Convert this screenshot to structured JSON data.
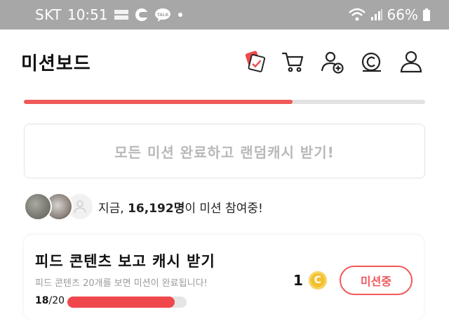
{
  "status_bar": {
    "carrier": "SKT",
    "time": "10:51",
    "battery": "66%",
    "icons": [
      "memo-icon",
      "c-icon",
      "talk-icon",
      "dot-icon",
      "wifi-icon",
      "signal-icon",
      "battery-icon"
    ],
    "talk_label": "TALK"
  },
  "header": {
    "title": "미션보드",
    "icons": [
      "mission-card-icon",
      "cart-icon",
      "add-friend-icon",
      "cash-icon",
      "profile-icon"
    ]
  },
  "progress": {
    "value": 0.67,
    "color": "#f0595a"
  },
  "cta": {
    "label": "모든 미션 완료하고 랜덤캐시 받기!"
  },
  "participants": {
    "prefix": "지금, ",
    "count": "16,192명",
    "suffix": "이 미션 참여중!"
  },
  "mission_card": {
    "title": "피드 콘텐츠 보고 캐시 받기",
    "description": "피드 콘텐츠 20개를 보면 미션이 완료됩니다!",
    "progress_current": "18",
    "progress_total": "/20",
    "progress_value": 0.9,
    "reward": "1",
    "coin_symbol": "C",
    "button_label": "미션중"
  },
  "colors": {
    "accent": "#f0595a",
    "status_bar": "#a7a7a7",
    "coin": "#f4c02e"
  }
}
